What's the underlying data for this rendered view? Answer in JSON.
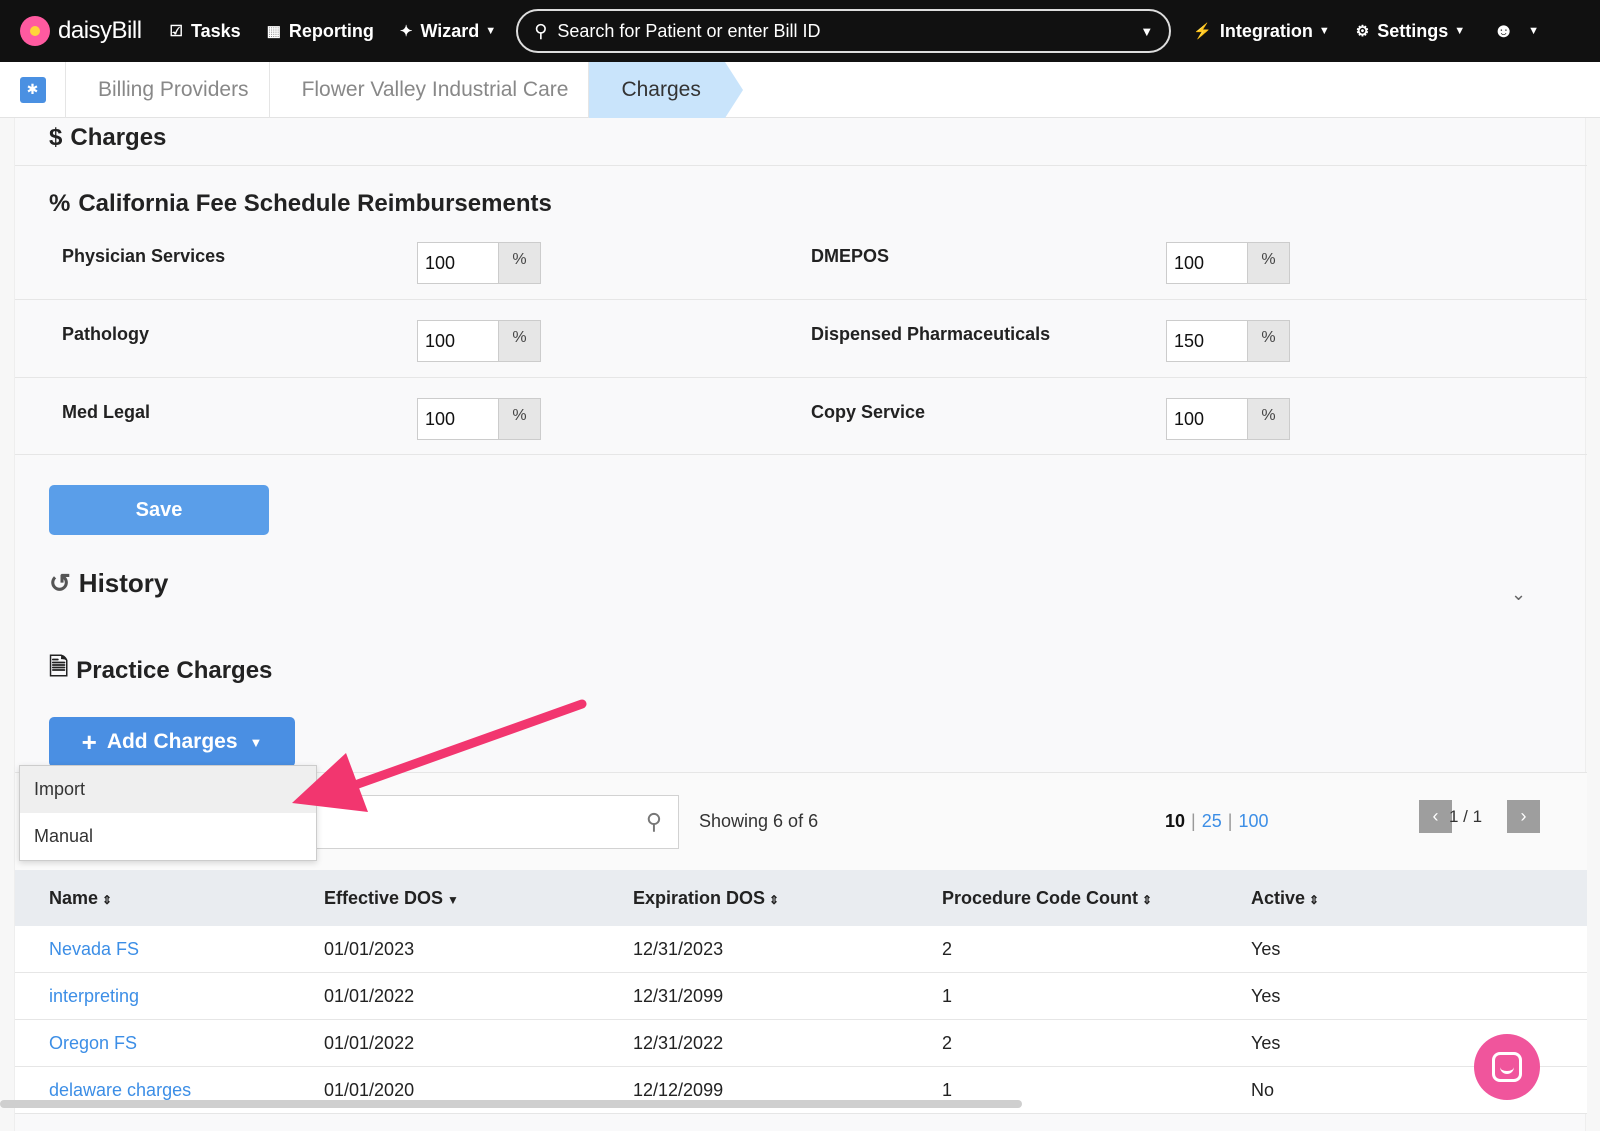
{
  "nav": {
    "logo": "daisyBill",
    "tasks": "Tasks",
    "reporting": "Reporting",
    "wizard": "Wizard",
    "search_placeholder": "Search for Patient or enter Bill ID",
    "integration": "Integration",
    "settings": "Settings"
  },
  "breadcrumbs": [
    "Billing Providers",
    "Flower Valley Industrial Care",
    "Charges"
  ],
  "charges_title": "Charges",
  "fee_schedule": {
    "title": "California Fee Schedule Reimbursements",
    "percent_symbol": "%",
    "items": [
      {
        "label": "Physician Services",
        "value": "100"
      },
      {
        "label": "DMEPOS",
        "value": "100"
      },
      {
        "label": "Pathology",
        "value": "100"
      },
      {
        "label": "Dispensed Pharmaceuticals",
        "value": "150"
      },
      {
        "label": "Med Legal",
        "value": "100"
      },
      {
        "label": "Copy Service",
        "value": "100"
      }
    ]
  },
  "save_label": "Save",
  "history_title": "History",
  "practice_charges_title": "Practice Charges",
  "add_charges_label": "Add Charges",
  "dropdown": [
    "Import",
    "Manual"
  ],
  "table_tools": {
    "showing": "Showing 6 of 6",
    "per_page": [
      "10",
      "25",
      "100"
    ],
    "page": "1 / 1"
  },
  "table": {
    "columns": [
      "Name",
      "Effective DOS",
      "Expiration DOS",
      "Procedure Code Count",
      "Active"
    ],
    "rows": [
      [
        "Nevada FS",
        "01/01/2023",
        "12/31/2023",
        "2",
        "Yes"
      ],
      [
        "interpreting",
        "01/01/2022",
        "12/31/2099",
        "1",
        "Yes"
      ],
      [
        "Oregon FS",
        "01/01/2022",
        "12/31/2022",
        "2",
        "Yes"
      ],
      [
        "delaware charges",
        "01/01/2020",
        "12/12/2099",
        "1",
        "No"
      ]
    ]
  },
  "colors": {
    "accent": "#4a8fe3",
    "link": "#3c8ee6",
    "annotation_arrow": "#f2366f",
    "chat": "#f0559c"
  }
}
